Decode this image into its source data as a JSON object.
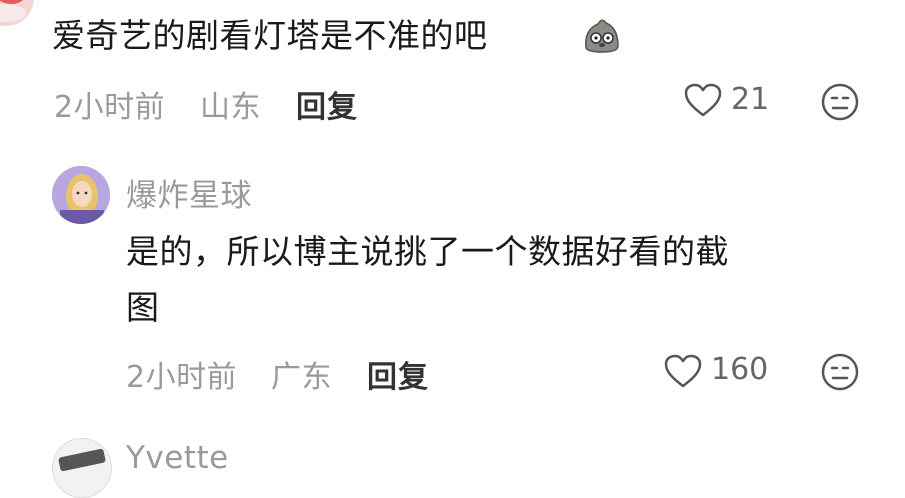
{
  "comment1": {
    "text": "爱奇艺的剧看灯塔是不准的吧",
    "emoji_icon": "pigeon-emoji-icon",
    "time": "2小时前",
    "location": "山东",
    "reply_label": "回复",
    "like_count": "21"
  },
  "reply1": {
    "username": "爆炸星球",
    "text_line1": "是的，所以博主说挑了一个数据好看的截",
    "text_line2": "图",
    "time": "2小时前",
    "location": "广东",
    "reply_label": "回复",
    "like_count": "160"
  },
  "reply2": {
    "username": "Yvette"
  },
  "colors": {
    "text": "#1a1a1a",
    "meta": "#9a9a9a",
    "icon": "#666666"
  }
}
